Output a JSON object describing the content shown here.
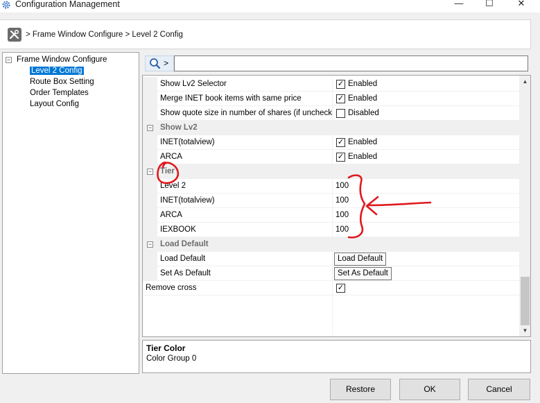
{
  "window": {
    "title": "Configuration Management",
    "controls": {
      "minimize": "—",
      "maximize": "☐",
      "close": "✕"
    }
  },
  "breadcrumb": {
    "text": "> Frame Window Configure  > Level 2 Config"
  },
  "tree": {
    "root": {
      "label": "Frame Window Configure",
      "expander": "−"
    },
    "children": [
      {
        "label": "Level 2 Config",
        "selected": true
      },
      {
        "label": "Route Box Setting"
      },
      {
        "label": "Order Templates"
      },
      {
        "label": "Layout Config"
      }
    ]
  },
  "search": {
    "button_arrow": ">",
    "value": ""
  },
  "grid": {
    "rows": {
      "show_lv2_selector": {
        "label": "Show Lv2 Selector",
        "check": "✓",
        "value": "Enabled"
      },
      "merge_inet": {
        "label": "Merge INET book items with same price",
        "check": "✓",
        "value": "Enabled"
      },
      "show_quote_size": {
        "label": "Show quote size in number of shares (if uncheck...",
        "check": "",
        "value": "Disabled"
      },
      "cat_show_lv2": {
        "label": "Show Lv2",
        "toggle": "−"
      },
      "inet_totalview": {
        "label": "INET(totalview)",
        "check": "✓",
        "value": "Enabled"
      },
      "arca": {
        "label": "ARCA",
        "check": "✓",
        "value": "Enabled"
      },
      "cat_tier": {
        "label": "Tier",
        "toggle": "−"
      },
      "tier_level2": {
        "label": "Level 2",
        "value": "100"
      },
      "tier_inet": {
        "label": "INET(totalview)",
        "value": "100"
      },
      "tier_arca": {
        "label": "ARCA",
        "value": "100"
      },
      "tier_iexbook": {
        "label": "IEXBOOK",
        "value": "100"
      },
      "cat_load_default": {
        "label": "Load Default",
        "toggle": "−"
      },
      "load_default": {
        "label": "Load Default",
        "button": "Load Default"
      },
      "set_as_default": {
        "label": "Set As Default",
        "button": "Set As Default"
      },
      "remove_cross": {
        "label": "Remove cross",
        "check": "✓"
      }
    }
  },
  "scrollbar": {
    "up": "▲",
    "down": "▼"
  },
  "description": {
    "title": "Tier Color",
    "text": "Color Group 0"
  },
  "buttons": {
    "restore": "Restore",
    "ok": "OK",
    "cancel": "Cancel"
  },
  "annotation_color": "#e0191e"
}
